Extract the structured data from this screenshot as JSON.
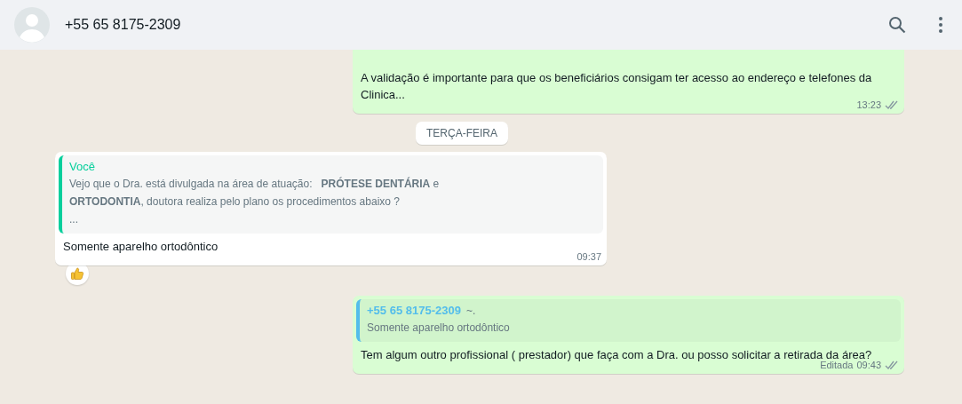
{
  "header": {
    "title": "+55 65 8175-2309"
  },
  "messages": [
    {
      "kind": "outgoing",
      "text": "A validação é importante para que os beneficiários consigam ter acesso ao endereço e telefones da Clinica...",
      "time": "13:23",
      "read": false
    },
    {
      "kind": "date",
      "text": "TERÇA-FEIRA"
    },
    {
      "kind": "incoming",
      "quote": {
        "author": "Você",
        "text": "Vejo que o Dra. está divulgada na área de atuação:   **PRÓTESE DENTÁRIA** e\n**ORTODONTIA**, doutora realiza pelo plano os procedimentos abaixo ?\n..."
      },
      "text": "Somente aparelho ortodôntico",
      "time": "09:37",
      "reacted": true
    },
    {
      "kind": "outgoing",
      "quote": {
        "author": "+55 65 8175-2309",
        "suffix": "~.",
        "text": "Somente aparelho ortodôntico"
      },
      "text": "Tem algum outro profissional ( prestador) que faça com a Dra. ou posso solicitar a retirada da área?",
      "edited": "Editada",
      "time": "09:43",
      "read": false
    }
  ]
}
